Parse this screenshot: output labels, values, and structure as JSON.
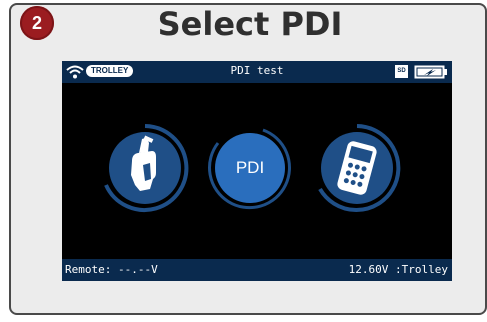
{
  "step": {
    "number": "2"
  },
  "header": {
    "title": "Select PDI"
  },
  "screen": {
    "status_bar": {
      "mode_tag": "TROLLEY",
      "title": "PDI test",
      "sd_label": "SD"
    },
    "buttons": {
      "pdi_label": "PDI"
    },
    "bottom_bar": {
      "remote": "Remote: --.--V",
      "voltage": "12.60V :Trolley"
    }
  },
  "colors": {
    "badge": "#9b1c20",
    "bar": "#0a2a4e",
    "button_fill": "#1f4f87",
    "pdi_fill": "#2a6ebd"
  },
  "icons": [
    "wifi-icon",
    "sd-card-icon",
    "battery-icon",
    "hand-tool-icon",
    "meter-device-icon"
  ]
}
